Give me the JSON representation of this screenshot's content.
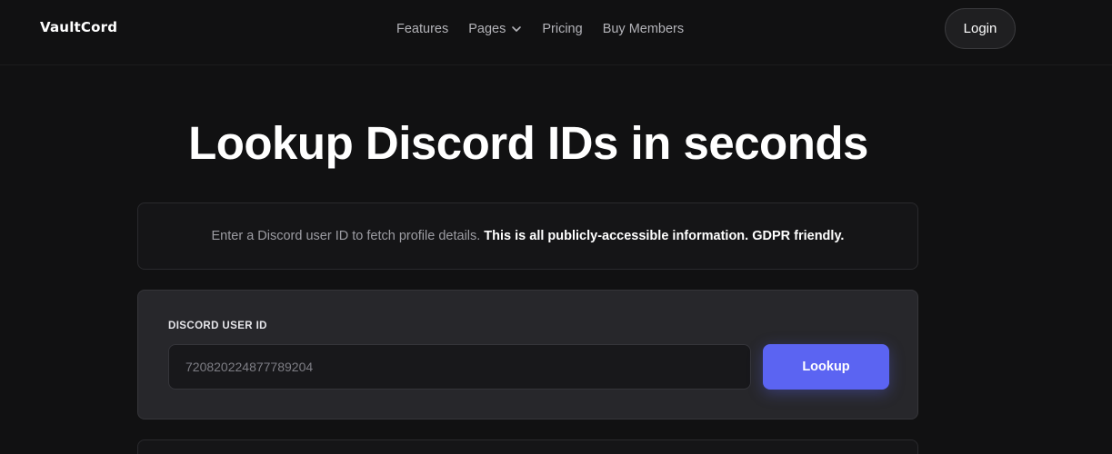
{
  "header": {
    "logo": "VaultCord",
    "nav": [
      {
        "label": "Features"
      },
      {
        "label": "Pages",
        "icon": "chevron-down-icon"
      },
      {
        "label": "Pricing"
      },
      {
        "label": "Buy Members"
      }
    ],
    "login_label": "Login"
  },
  "hero": {
    "title": "Lookup Discord IDs in seconds"
  },
  "info": {
    "text": "Enter a Discord user ID to fetch profile details.",
    "emphasis": "This is all publicly-accessible information. GDPR friendly."
  },
  "lookup": {
    "field_label": "DISCORD USER ID",
    "input_placeholder": "720820224877789204",
    "input_value": "",
    "button_label": "Lookup"
  },
  "colors": {
    "background": "#111112",
    "accent": "#5b64f2",
    "card": "#27272b"
  }
}
